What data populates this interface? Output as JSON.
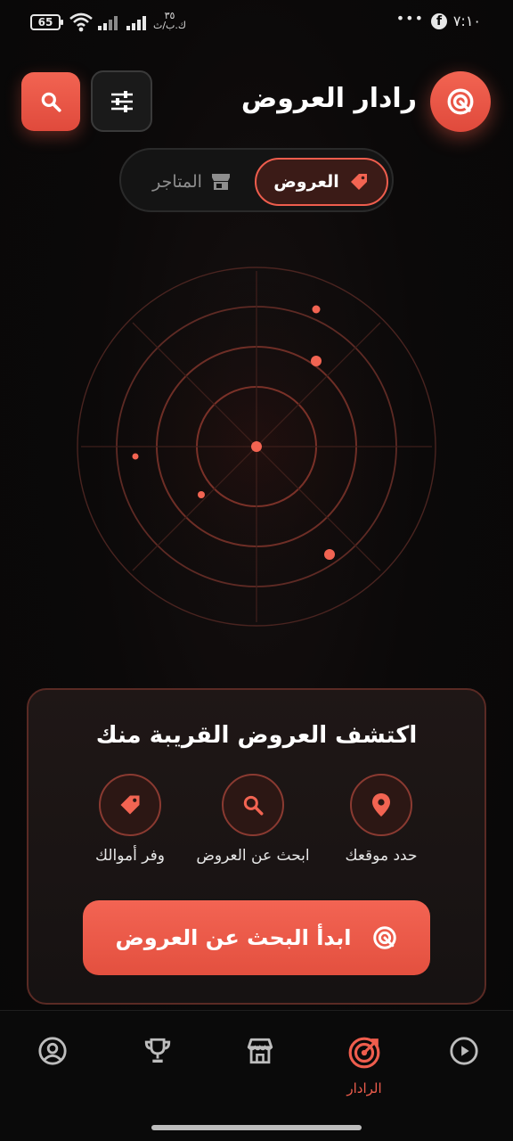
{
  "status_bar": {
    "time": "٧:١٠",
    "more": "•••",
    "facebook": "f",
    "battery": "65",
    "speed_value": "٣٥",
    "speed_unit": "ك.ب/ث"
  },
  "header": {
    "title": "رادار العروض",
    "logo_icon": "radar-target-icon",
    "filter_icon": "sliders-icon",
    "search_icon": "search-icon"
  },
  "tabs": [
    {
      "label": "العروض",
      "icon": "tag-icon",
      "active": true
    },
    {
      "label": "المتاجر",
      "icon": "store-icon",
      "active": false
    }
  ],
  "card": {
    "title": "اكتشف العروض القريبة منك",
    "features": [
      {
        "label": "حدد موقعك",
        "icon": "location-pin-icon"
      },
      {
        "label": "ابحث عن العروض",
        "icon": "search-icon"
      },
      {
        "label": "وفر أموالك",
        "icon": "tag-icon"
      }
    ],
    "cta_label": "ابدأ البحث عن العروض",
    "cta_icon": "radar-target-icon"
  },
  "bottom_nav": [
    {
      "name": "play",
      "icon": "play-circle-icon",
      "label": ""
    },
    {
      "name": "radar",
      "icon": "radar-target-icon",
      "label": "الرادار",
      "active": true
    },
    {
      "name": "store",
      "icon": "store-icon",
      "label": ""
    },
    {
      "name": "trophy",
      "icon": "trophy-icon",
      "label": ""
    },
    {
      "name": "profile",
      "icon": "user-circle-icon",
      "label": ""
    }
  ],
  "colors": {
    "accent": "#EE5D4D",
    "background": "#0A0A0A",
    "card_border": "#5A2A24"
  }
}
